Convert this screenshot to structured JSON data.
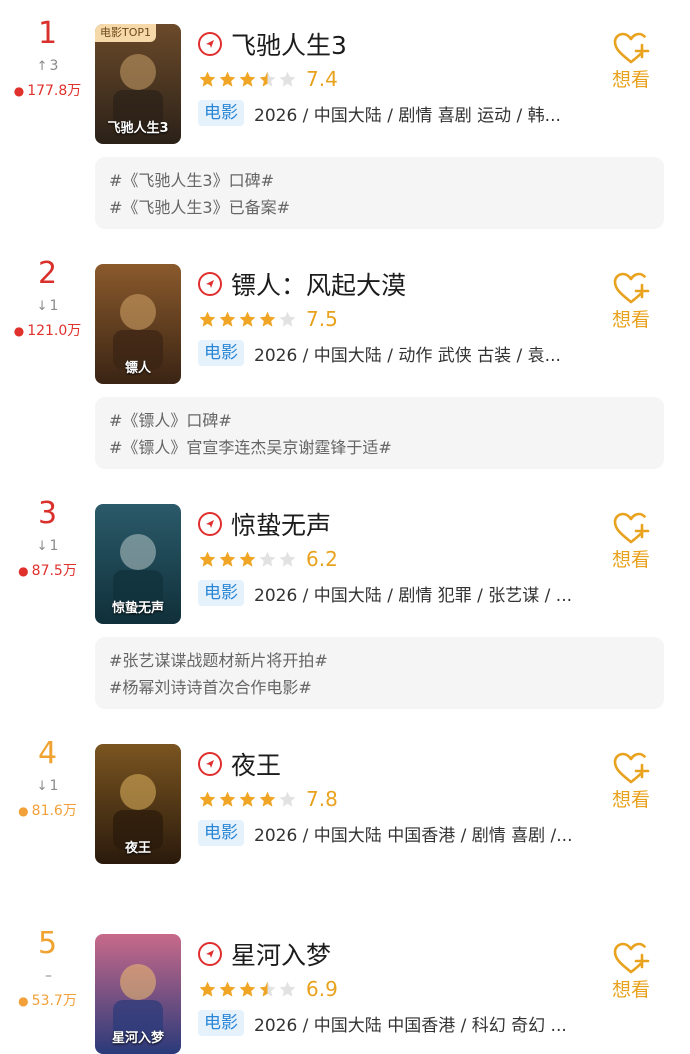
{
  "colors": {
    "rank_top": "#d9302c",
    "rank_other": "#f0a331",
    "heat_top": "#e0302c",
    "heat_other": "#f2a13a",
    "accent_gold": "#e9a21d",
    "tag_bg": "#e5f1fb",
    "tag_text": "#2a86d6"
  },
  "want_label": "想看",
  "items": [
    {
      "rank": "1",
      "change": "3",
      "change_dir": "up",
      "heat": "177.8万",
      "poster_badge": "电影TOP1",
      "poster_text": "飞驰人生3",
      "title": "飞驰人生3",
      "stars": 3.5,
      "score": "7.4",
      "type_tag": "电影",
      "meta": "2026 / 中国大陆 / 剧情 喜剧 运动 / 韩...",
      "topics": [
        "#《飞驰人生3》口碑#",
        "#《飞驰人生3》已备案#"
      ]
    },
    {
      "rank": "2",
      "change": "1",
      "change_dir": "down",
      "heat": "121.0万",
      "poster_text": "镖人",
      "title": "镖人：风起大漠",
      "stars": 4,
      "score": "7.5",
      "type_tag": "电影",
      "meta": "2026 / 中国大陆 / 动作 武侠 古装 / 袁...",
      "topics": [
        "#《镖人》口碑#",
        "#《镖人》官宣李连杰吴京谢霆锋于适#"
      ]
    },
    {
      "rank": "3",
      "change": "1",
      "change_dir": "down",
      "heat": "87.5万",
      "poster_text": "惊蛰无声",
      "title": "惊蛰无声",
      "stars": 3,
      "score": "6.2",
      "type_tag": "电影",
      "meta": "2026 / 中国大陆 / 剧情 犯罪 / 张艺谋 / ...",
      "topics": [
        "#张艺谋谍战题材新片将开拍#",
        "#杨幂刘诗诗首次合作电影#"
      ]
    },
    {
      "rank": "4",
      "change": "1",
      "change_dir": "down",
      "heat": "81.6万",
      "poster_text": "夜王",
      "title": "夜王",
      "stars": 4,
      "score": "7.8",
      "type_tag": "电影",
      "meta": "2026 / 中国大陆 中国香港 / 剧情 喜剧 /...",
      "topics": []
    },
    {
      "rank": "5",
      "change": "–",
      "change_dir": "none",
      "heat": "53.7万",
      "poster_text": "星河入梦",
      "title": "星河入梦",
      "stars": 3.5,
      "score": "6.9",
      "type_tag": "电影",
      "meta": "2026 / 中国大陆 中国香港 / 科幻 奇幻 ...",
      "topics": []
    }
  ]
}
